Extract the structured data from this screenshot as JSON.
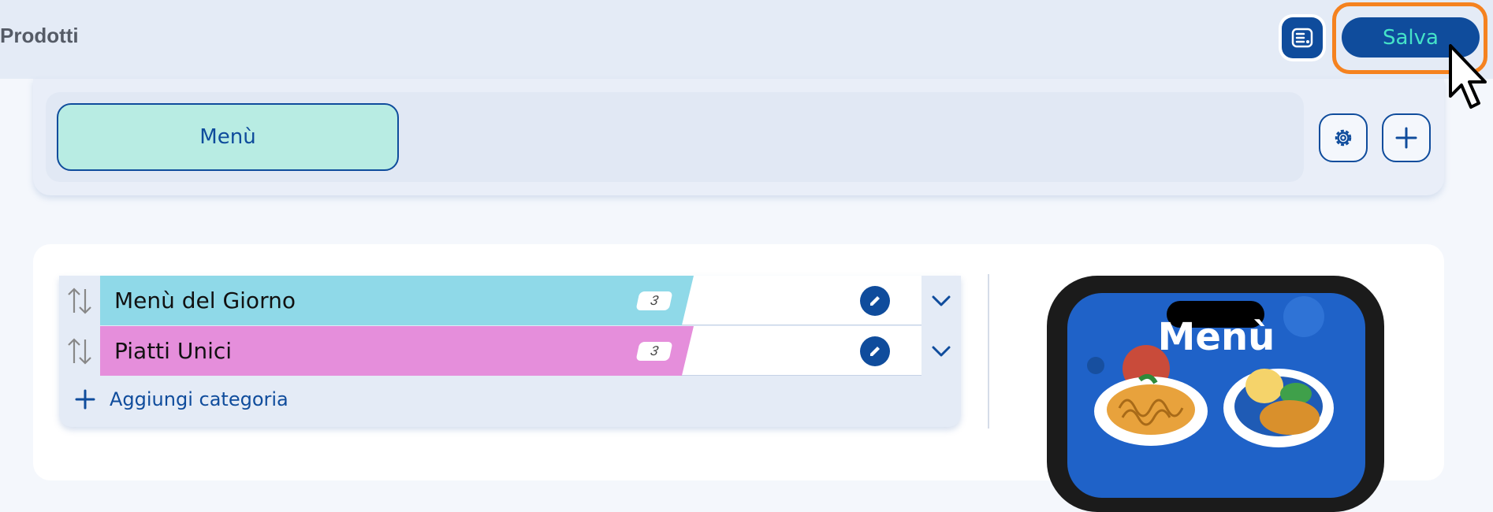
{
  "header": {
    "title": "Prodotti",
    "save_label": "Salva",
    "list_icon": "list-settings-icon"
  },
  "menus": {
    "tabs": [
      {
        "label": "Menù"
      }
    ],
    "settings_icon": "gear-icon",
    "add_icon": "plus-icon"
  },
  "categories": {
    "items": [
      {
        "name": "Menù del Giorno",
        "count": "3",
        "color": "#8fd9e8"
      },
      {
        "name": "Piatti Unici",
        "count": "3",
        "color": "#e58edb"
      }
    ],
    "add_label": "Aggiungi categoria"
  },
  "preview": {
    "title": "Menù"
  },
  "colors": {
    "primary": "#0f4c9c",
    "accent": "#45e3c8",
    "highlight": "#f5821f"
  }
}
